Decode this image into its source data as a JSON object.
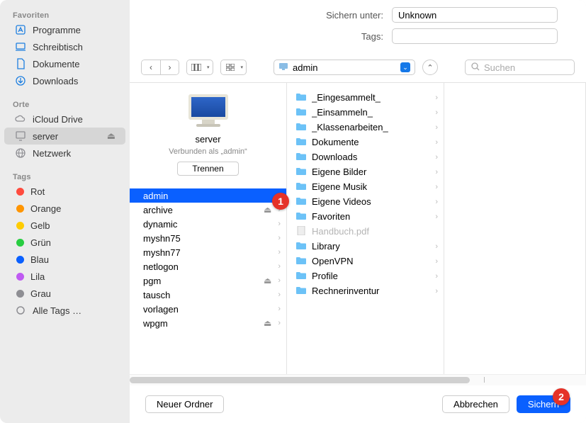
{
  "sidebar": {
    "sections": {
      "favorites_label": "Favoriten",
      "locations_label": "Orte",
      "tags_label": "Tags"
    },
    "favorites": [
      {
        "label": "Programme",
        "icon": "app"
      },
      {
        "label": "Schreibtisch",
        "icon": "desk"
      },
      {
        "label": "Dokumente",
        "icon": "doc"
      },
      {
        "label": "Downloads",
        "icon": "down"
      }
    ],
    "locations": [
      {
        "label": "iCloud Drive",
        "icon": "cloud",
        "eject": false,
        "selected": false
      },
      {
        "label": "server",
        "icon": "display",
        "eject": true,
        "selected": true
      },
      {
        "label": "Netzwerk",
        "icon": "globe",
        "eject": false,
        "selected": false
      }
    ],
    "tags": [
      {
        "label": "Rot",
        "color": "#ff4b3e"
      },
      {
        "label": "Orange",
        "color": "#ff9500"
      },
      {
        "label": "Gelb",
        "color": "#ffcc00"
      },
      {
        "label": "Grün",
        "color": "#28cd41"
      },
      {
        "label": "Blau",
        "color": "#0a60ff"
      },
      {
        "label": "Lila",
        "color": "#bf5af2"
      },
      {
        "label": "Grau",
        "color": "#8e8e93"
      }
    ],
    "all_tags_label": "Alle Tags …"
  },
  "header": {
    "save_as_label": "Sichern unter:",
    "save_as_value": "Unknown",
    "tags_label": "Tags:"
  },
  "toolbar": {
    "path_label": "admin",
    "search_placeholder": "Suchen"
  },
  "server_panel": {
    "name": "server",
    "status": "Verbunden als „admin“",
    "disconnect_label": "Trennen"
  },
  "shares": [
    {
      "label": "admin",
      "selected": true,
      "eject": false
    },
    {
      "label": "archive",
      "selected": false,
      "eject": true
    },
    {
      "label": "dynamic",
      "selected": false,
      "eject": false
    },
    {
      "label": "myshn75",
      "selected": false,
      "eject": false
    },
    {
      "label": "myshn77",
      "selected": false,
      "eject": false
    },
    {
      "label": "netlogon",
      "selected": false,
      "eject": false
    },
    {
      "label": "pgm",
      "selected": false,
      "eject": true
    },
    {
      "label": "tausch",
      "selected": false,
      "eject": false
    },
    {
      "label": "vorlagen",
      "selected": false,
      "eject": false
    },
    {
      "label": "wpgm",
      "selected": false,
      "eject": true
    }
  ],
  "folders": [
    {
      "label": "_Eingesammelt_",
      "type": "folder"
    },
    {
      "label": "_Einsammeln_",
      "type": "folder"
    },
    {
      "label": "_Klassenarbeiten_",
      "type": "folder"
    },
    {
      "label": "Dokumente",
      "type": "folder"
    },
    {
      "label": "Downloads",
      "type": "folder"
    },
    {
      "label": "Eigene Bilder",
      "type": "folder"
    },
    {
      "label": "Eigene Musik",
      "type": "folder"
    },
    {
      "label": "Eigene Videos",
      "type": "folder"
    },
    {
      "label": "Favoriten",
      "type": "folder"
    },
    {
      "label": "Handbuch.pdf",
      "type": "file",
      "disabled": true
    },
    {
      "label": "Library",
      "type": "folder"
    },
    {
      "label": "OpenVPN",
      "type": "folder"
    },
    {
      "label": "Profile",
      "type": "folder"
    },
    {
      "label": "Rechnerinventur",
      "type": "folder"
    }
  ],
  "footer": {
    "new_folder_label": "Neuer Ordner",
    "cancel_label": "Abbrechen",
    "save_label": "Sichern"
  },
  "markers": {
    "m1": "1",
    "m2": "2"
  }
}
